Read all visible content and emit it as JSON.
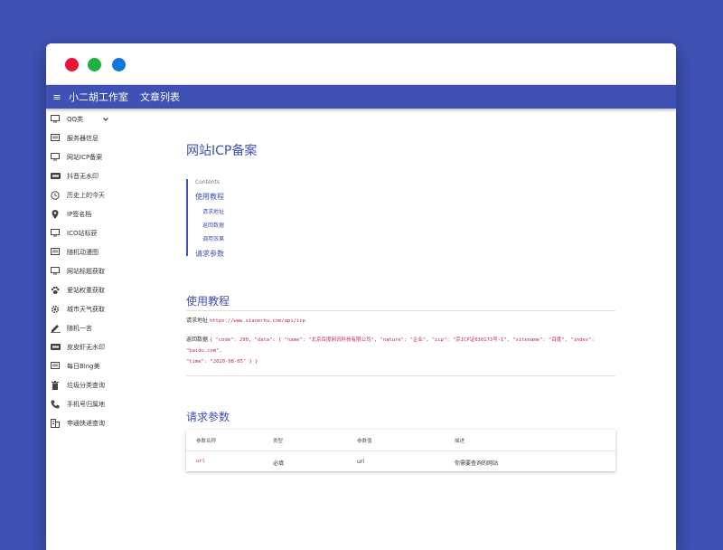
{
  "window_controls": [
    "close",
    "minimize",
    "maximize"
  ],
  "appbar": {
    "menu_icon": "≡",
    "brand": "小二胡工作室",
    "nav_link": "文章列表"
  },
  "sidebar": {
    "items": [
      {
        "label": "QQ类",
        "icon": "monitor-icon",
        "has_chevron": true
      },
      {
        "label": "服务器信息",
        "icon": "message-icon"
      },
      {
        "label": "网站ICP备案",
        "icon": "monitor-icon"
      },
      {
        "label": "抖音无水印",
        "icon": "new-badge-icon"
      },
      {
        "label": "历史上的今天",
        "icon": "clock-icon"
      },
      {
        "label": "IP签名档",
        "icon": "location-pin-icon"
      },
      {
        "label": "ICO站标获",
        "icon": "monitor-icon"
      },
      {
        "label": "随机动漫图",
        "icon": "message-icon"
      },
      {
        "label": "网站标题获取",
        "icon": "monitor-icon"
      },
      {
        "label": "爱站权重获取",
        "icon": "paw-icon"
      },
      {
        "label": "城市天气获取",
        "icon": "gear-icon"
      },
      {
        "label": "随机一言",
        "icon": "pen-icon"
      },
      {
        "label": "皮皮虾无水印",
        "icon": "new-badge-icon"
      },
      {
        "label": "每日Bing美",
        "icon": "message-icon"
      },
      {
        "label": "垃圾分类查询",
        "icon": "trash-icon"
      },
      {
        "label": "手机号归属地",
        "icon": "phone-icon"
      },
      {
        "label": "申通快递查询",
        "icon": "building-icon"
      }
    ]
  },
  "main": {
    "title": "网站ICP备案",
    "toc": {
      "heading": "Contents",
      "items": [
        {
          "label": "使用教程",
          "level": 1
        },
        {
          "label": "请求地址",
          "level": 2
        },
        {
          "label": "返回数据",
          "level": 2
        },
        {
          "label": "调用效果",
          "level": 2
        },
        {
          "label": "请求参数",
          "level": 1
        }
      ]
    },
    "usage": {
      "heading": "使用教程",
      "request_label": "请求地址",
      "request_url": "https://www.xiaoerhu.com/api/icp",
      "response_label": "返回数据",
      "response_line1": "{ \"code\": 200, \"data\": { \"name\": \"北京百度网讯科技有限公司\", \"nature\": \"企业\", \"icp\": \"京ICP证030173号-1\", \"sitename\": \"百度\", \"index\": \"baidu.com\",",
      "response_line2": "\"time\": \"2020-08-05\" } }"
    },
    "params": {
      "heading": "请求参数",
      "columns": [
        "参数名称",
        "类型",
        "参数值",
        "描述"
      ],
      "rows": [
        {
          "name": "url",
          "type": "必填",
          "value": "url",
          "desc": "你需要查询的网站"
        }
      ]
    }
  },
  "colors": {
    "background": "#3f51b5",
    "primary": "#3f51b5",
    "code": "#c7254e",
    "dot_red": "#e8173a",
    "dot_green": "#1fb141",
    "dot_blue": "#1177d9"
  }
}
